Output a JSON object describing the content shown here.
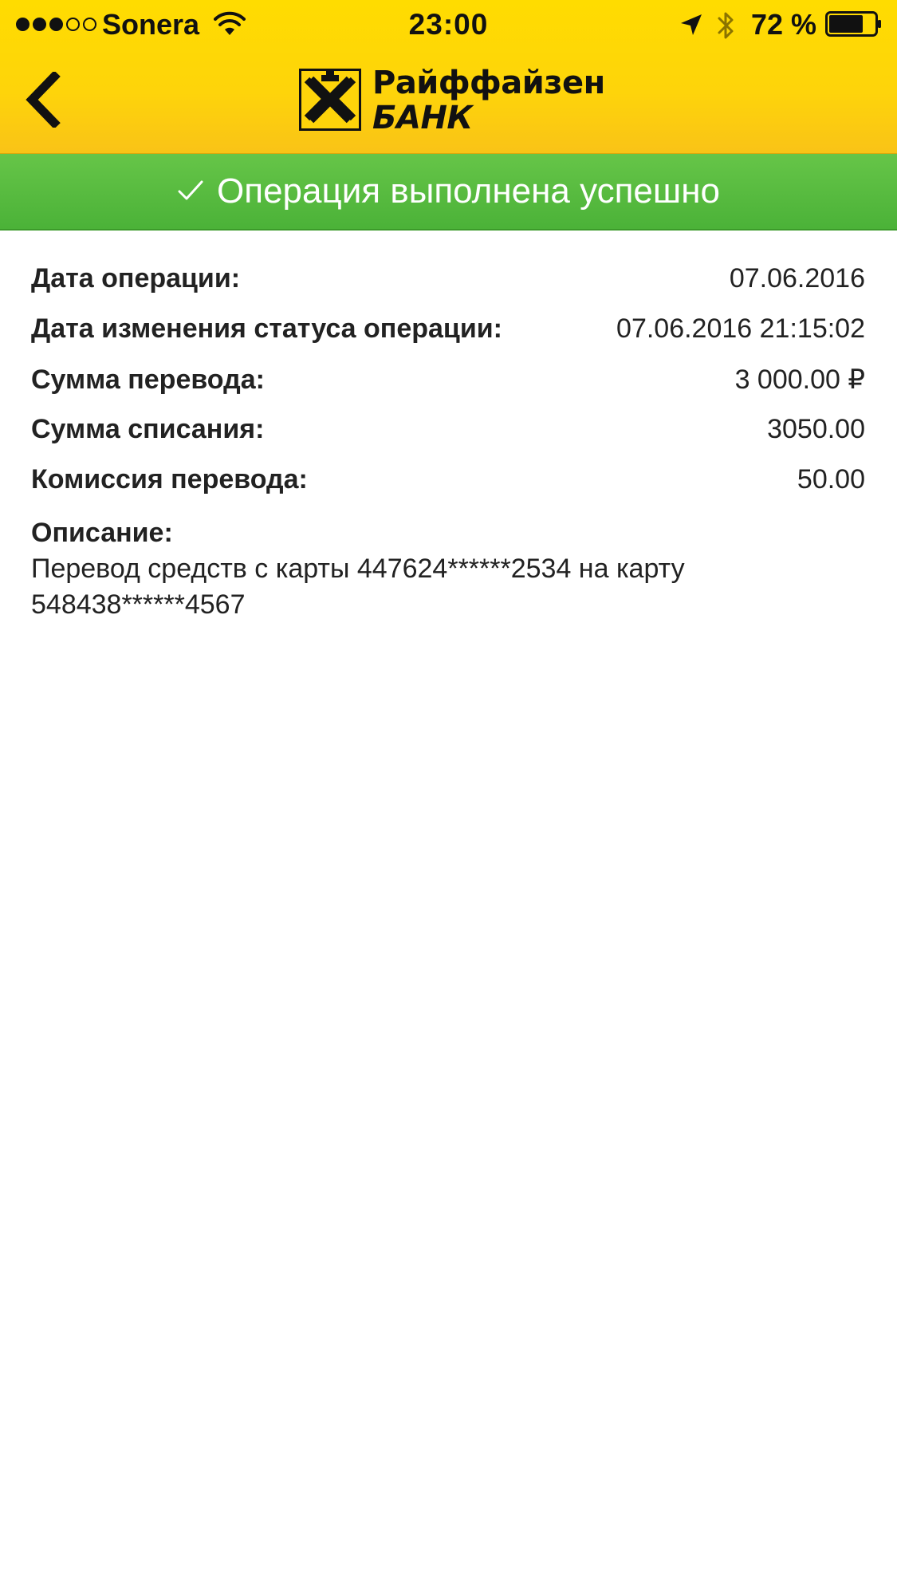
{
  "status_bar": {
    "carrier": "Sonera",
    "time": "23:00",
    "battery": "72 %",
    "signal_bars_filled": 3,
    "signal_bars_total": 5
  },
  "nav": {
    "back_icon": "chevron-left-icon",
    "logo_line1": "Райффайзен",
    "logo_line2": "БАНК"
  },
  "banner": {
    "icon": "checkmark-icon",
    "text": "Операция выполнена успешно",
    "color": "#55b93e"
  },
  "details": {
    "rows": [
      {
        "label": "Дата операции:",
        "value": "07.06.2016"
      },
      {
        "label": "Дата изменения статуса операции:",
        "value": "07.06.2016 21:15:02"
      },
      {
        "label": "Сумма перевода:",
        "value": "3 000.00 ₽"
      },
      {
        "label": "Сумма списания:",
        "value": "3050.00"
      },
      {
        "label": "Комиссия перевода:",
        "value": "50.00"
      }
    ],
    "description_label": "Описание:",
    "description_text": "Перевод средств с карты 447624******2534 на карту 548438******4567"
  },
  "colors": {
    "header_yellow": "#fed40a",
    "success_green": "#55b93e"
  }
}
